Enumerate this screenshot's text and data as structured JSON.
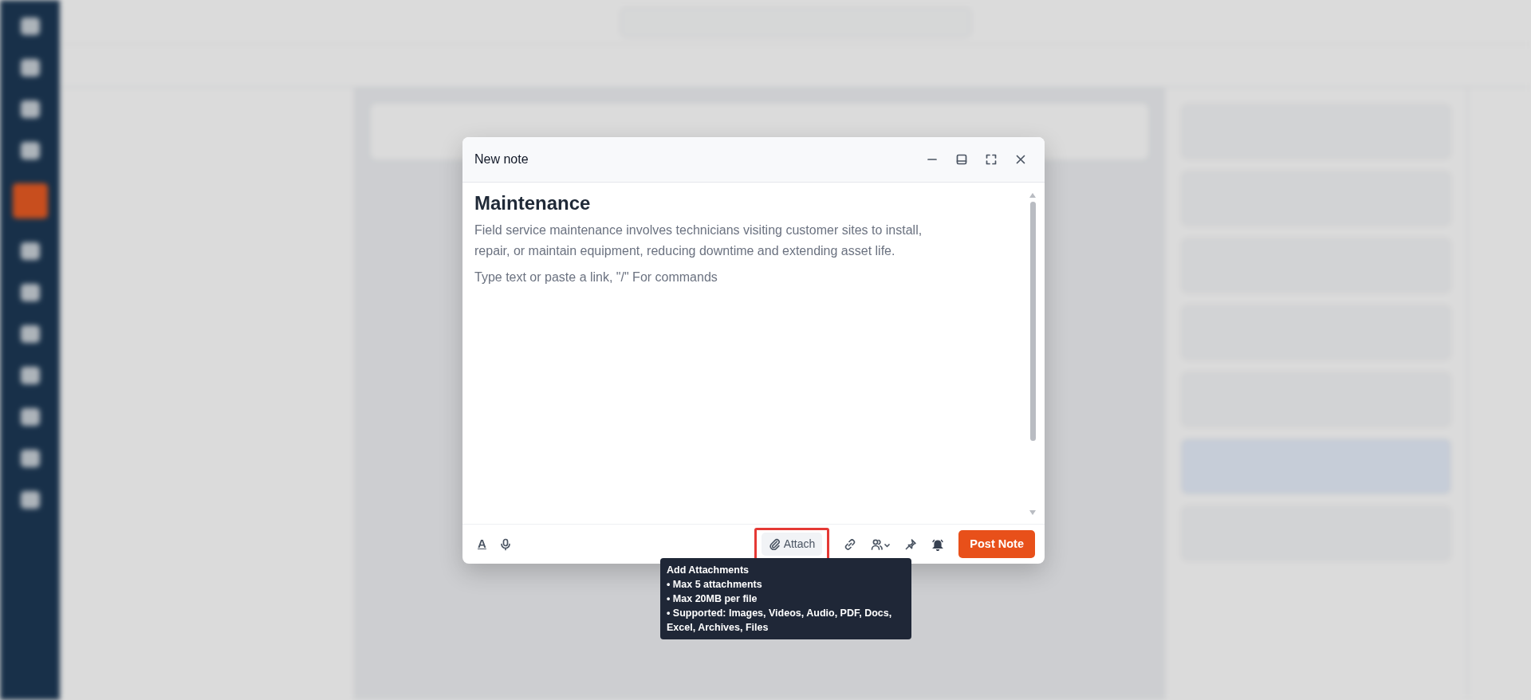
{
  "note_dialog": {
    "title": "New note",
    "heading": "Maintenance",
    "body": "Field service maintenance involves technicians visiting customer sites to install, repair, or maintain equipment, reducing downtime and extending asset life.",
    "placeholder": "Type text or paste a link, \"/\" For commands",
    "format_button": "A",
    "attach_button": {
      "label": "Attach",
      "highlighted": true
    },
    "post_button": "Post Note",
    "tooltip": {
      "title": "Add Attachments",
      "lines": [
        "• Max 5 attachments",
        "• Max 20MB per file",
        "• Supported: Images, Videos, Audio, PDF, Docs, Excel, Archives, Files"
      ]
    }
  }
}
